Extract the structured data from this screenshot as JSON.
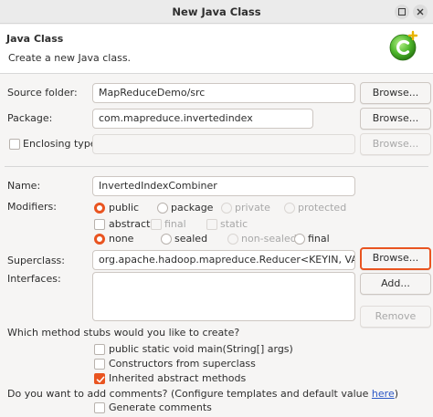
{
  "window": {
    "title": "New Java Class"
  },
  "header": {
    "title": "Java Class",
    "subtitle": "Create a new Java class."
  },
  "source_folder": {
    "label": "Source folder:",
    "value": "MapReduceDemo/src",
    "browse": "Browse..."
  },
  "package": {
    "label": "Package:",
    "value": "com.mapreduce.invertedindex",
    "browse": "Browse..."
  },
  "enclosing_type": {
    "label": "Enclosing type:",
    "value": "",
    "browse": "Browse...",
    "checked": false
  },
  "name": {
    "label": "Name:",
    "value": "InvertedIndexCombiner"
  },
  "modifiers": {
    "label": "Modifiers:",
    "access": [
      "public",
      "package",
      "private",
      "protected"
    ],
    "access_selected": "public",
    "flags": [
      "abstract",
      "final",
      "static"
    ],
    "inheritance": [
      "none",
      "sealed",
      "non-sealed",
      "final"
    ],
    "inheritance_selected": "none"
  },
  "superclass": {
    "label": "Superclass:",
    "value": "org.apache.hadoop.mapreduce.Reducer<KEYIN, VALUEIN",
    "browse": "Browse..."
  },
  "interfaces": {
    "label": "Interfaces:",
    "add": "Add...",
    "remove": "Remove"
  },
  "stubs": {
    "question": "Which method stubs would you like to create?",
    "options": [
      {
        "label": "public static void main(String[] args)",
        "checked": false
      },
      {
        "label": "Constructors from superclass",
        "checked": false
      },
      {
        "label": "Inherited abstract methods",
        "checked": true
      }
    ]
  },
  "comments": {
    "question": "Do you want to add comments? (Configure templates and default value ",
    "link": "here",
    "close": ")",
    "option": "Generate comments",
    "checked": false
  },
  "colors": {
    "accent": "#e95420",
    "link": "#2a56c6"
  }
}
